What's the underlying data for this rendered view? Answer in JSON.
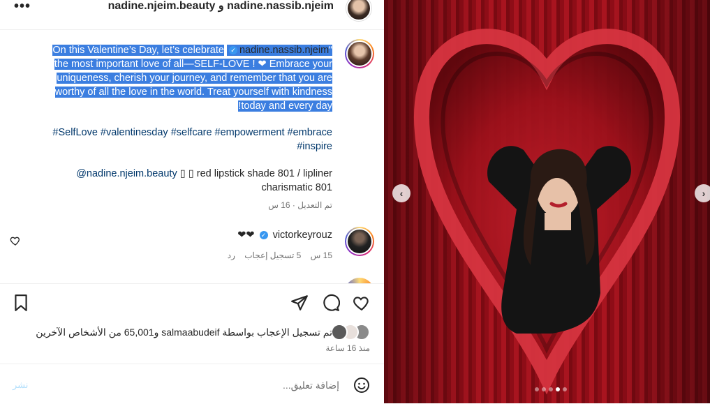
{
  "header": {
    "title": "nadine.nassib.njeim و nadine.njeim.beauty",
    "more_icon": "more-horizontal-icon"
  },
  "caption": {
    "text_part1": "“On this Valentine’s Day, let’s celebrate",
    "author": "nadine.nassib.njeim",
    "text_part2": "the most important love of all—SELF-LOVE ! ❤ Embrace your uniqueness, cherish your journey, and remember that you are worthy of all the love in the world. Treat yourself with kindness today and every day!",
    "hashtags": "#SelfLove #valentinesday #selfcare #empowerment #embrace #inspire",
    "mention": "@nadine.njeim.beauty",
    "mention_rest": "▯ ▯ red lipstick shade 801 / lipliner charismatic 801",
    "edited_time": "تم التعديل · 16 س"
  },
  "comment": {
    "user": "victorkeyrouz",
    "text": "❤❤",
    "time": "15 س",
    "likes": "5 تسجيل إعجاب",
    "reply": "رد"
  },
  "actions": {
    "likes_text": "تم تسجيل الإعجاب بواسطة salmaabudeif و65,001 من الأشخاص الآخرين",
    "time_ago": "منذ 16 ساعة",
    "comment_placeholder": "إضافة تعليق...",
    "post_label": "نشر"
  },
  "carousel": {
    "dot_count": 5,
    "active_index": 3
  },
  "colors": {
    "selection": "#3b7ee0",
    "link": "#00376b",
    "muted": "#737373",
    "verified": "#3897f0"
  }
}
